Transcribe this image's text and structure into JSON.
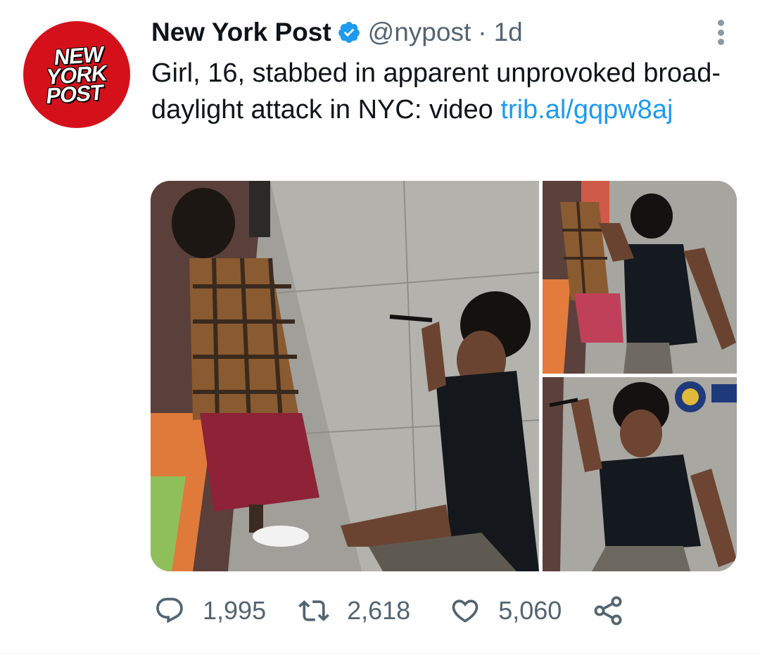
{
  "avatar": {
    "logo_lines": [
      "NEW",
      "YORK",
      "POST"
    ],
    "background": "#d4111b"
  },
  "tweet": {
    "author_name": "New York Post",
    "verified_icon": "verified-badge-icon",
    "handle": "@nypost",
    "separator": "·",
    "time": "1d",
    "text": "Girl, 16, stabbed in apparent unprovoked broad-daylight attack in NYC: video ",
    "link": "trib.al/​gqpw8aj",
    "more_icon": "more-options-icon"
  },
  "media": {
    "images": [
      {
        "name": "main-image",
        "depicts": "street-surveillance-still"
      },
      {
        "name": "secondary-image-top",
        "depicts": "street-surveillance-still"
      },
      {
        "name": "secondary-image-bottom",
        "depicts": "street-surveillance-still"
      }
    ]
  },
  "actions": {
    "reply": {
      "icon": "reply-icon",
      "count": "1,995"
    },
    "retweet": {
      "icon": "retweet-icon",
      "count": "2,618"
    },
    "like": {
      "icon": "heart-icon",
      "count": "5,060"
    },
    "share": {
      "icon": "share-icon"
    }
  },
  "colors": {
    "link": "#1d9bf0",
    "secondary_text": "#536471",
    "verified": "#1d9bf0",
    "text": "#0f1419"
  }
}
